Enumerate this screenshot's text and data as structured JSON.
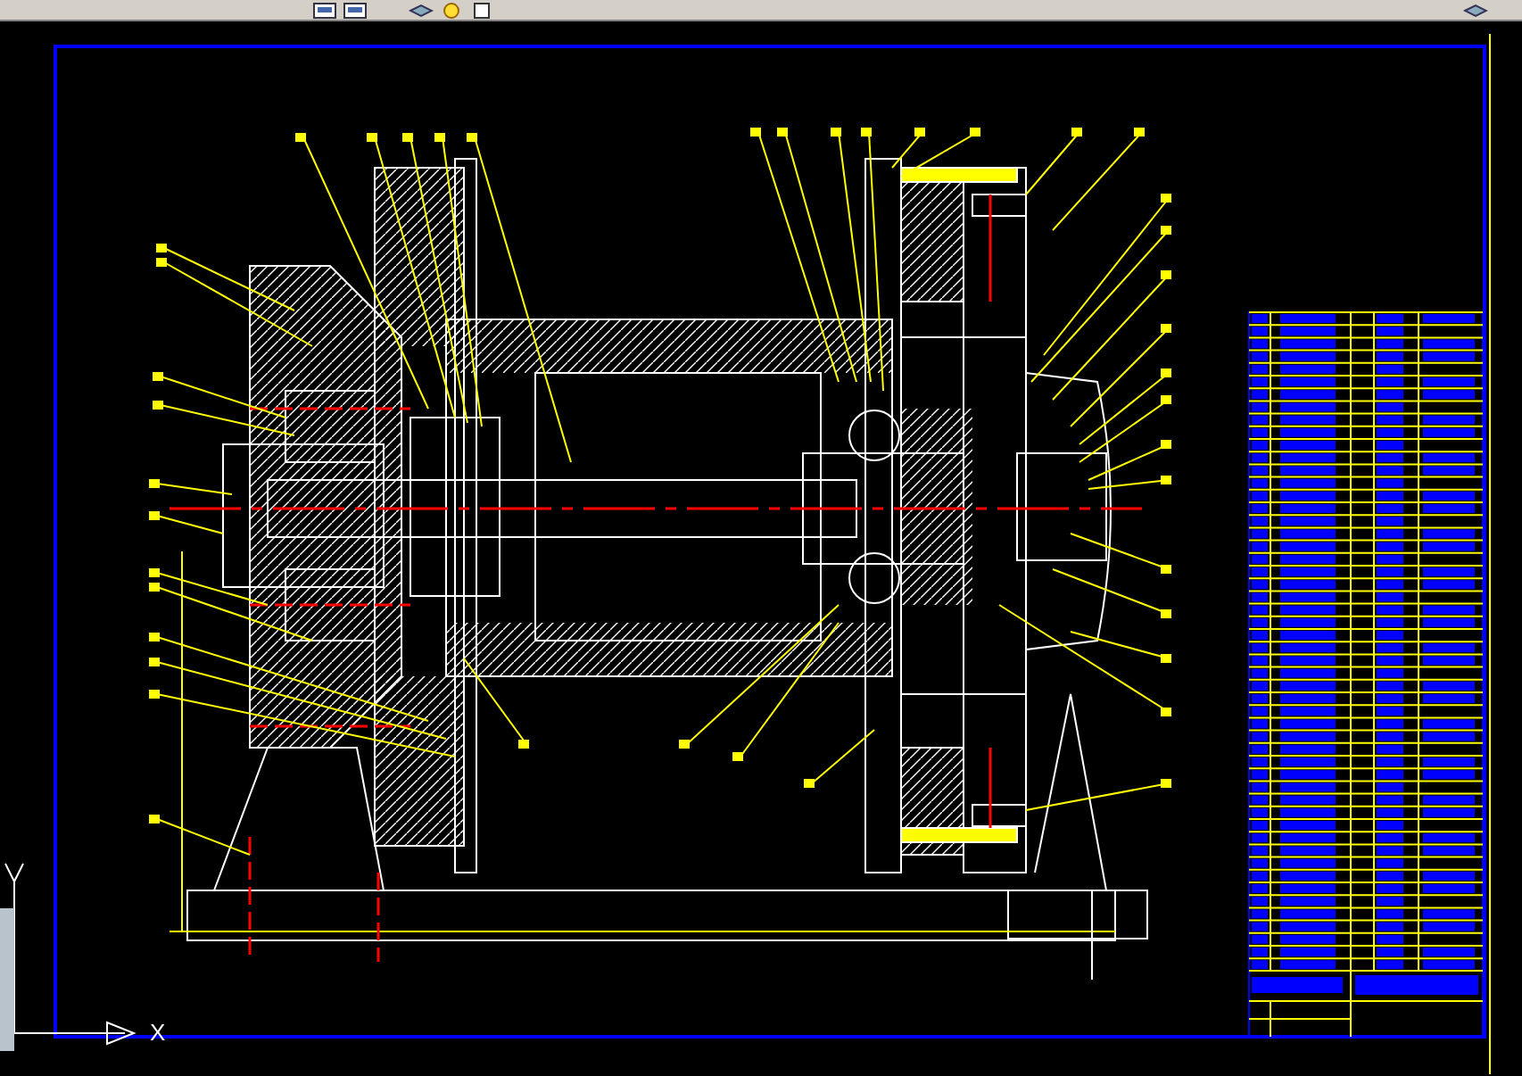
{
  "toolbar": {
    "icons": [
      {
        "kind": "window"
      },
      {
        "kind": "window"
      },
      {
        "kind": "layers"
      },
      {
        "kind": "bulb"
      },
      {
        "kind": "square"
      },
      {
        "kind": "layers"
      }
    ]
  },
  "ucs": {
    "x_label": "X"
  }
}
